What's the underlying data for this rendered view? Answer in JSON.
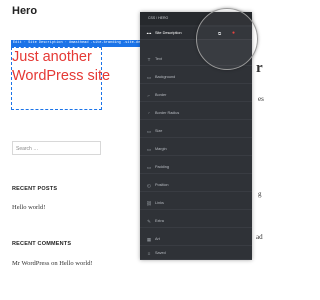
{
  "page": {
    "title": "Hero",
    "selector_path": "Edit · Site Description · #masthead .site-branding .site-descr"
  },
  "hero": {
    "site_description": "Just another WordPress site"
  },
  "sidebar": {
    "search_placeholder": "Search …",
    "recent_posts_title": "RECENT POSTS",
    "recent_post": "Hello world!",
    "recent_comments_title": "RECENT COMMENTS",
    "comment_author": "Mr WordPress",
    "comment_connector": "on",
    "comment_post": "Hello world!"
  },
  "peek": {
    "big_letter": "r",
    "rs": "es",
    "g": "g",
    "ad": "ad"
  },
  "panel": {
    "header": "CSS / HERO",
    "items": [
      {
        "icon": "•••",
        "label": "Site Description",
        "active": true
      },
      {
        "icon": "T",
        "label": "Text"
      },
      {
        "icon": "▭",
        "label": "Background"
      },
      {
        "icon": "⌐",
        "label": "Border"
      },
      {
        "icon": "◜",
        "label": "Border Radius"
      },
      {
        "icon": "▭",
        "label": "Size"
      },
      {
        "icon": "▭",
        "label": "Margin"
      },
      {
        "icon": "▭",
        "label": "Padding"
      },
      {
        "icon": "◵",
        "label": "Position"
      },
      {
        "icon": "⛓",
        "label": "Links"
      },
      {
        "icon": "✎",
        "label": "Extra"
      },
      {
        "icon": "▦",
        "label": "Art"
      },
      {
        "icon": "≡",
        "label": "Saved"
      }
    ]
  }
}
